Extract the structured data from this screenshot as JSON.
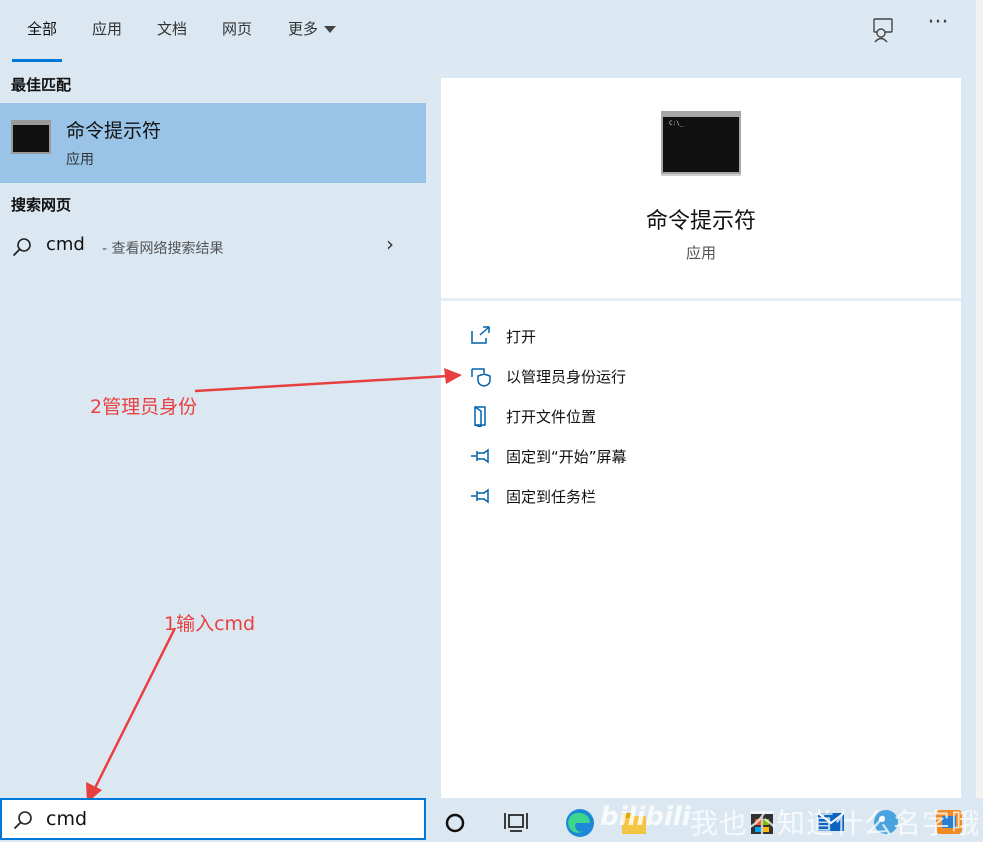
{
  "tabs": [
    {
      "label": "全部",
      "active": true
    },
    {
      "label": "应用"
    },
    {
      "label": "文档"
    },
    {
      "label": "网页"
    },
    {
      "label": "更多"
    }
  ],
  "sections": {
    "best_match": "最佳匹配",
    "search_web": "搜索网页"
  },
  "best_match_item": {
    "title": "命令提示符",
    "subtitle": "应用"
  },
  "web_result": {
    "query": "cmd",
    "hint": " - 查看网络搜索结果"
  },
  "detail": {
    "title": "命令提示符",
    "subtitle": "应用",
    "actions": [
      {
        "label": "打开",
        "icon": "open-icon"
      },
      {
        "label": "以管理员身份运行",
        "icon": "shield-icon"
      },
      {
        "label": "打开文件位置",
        "icon": "folder-icon"
      },
      {
        "label": "固定到“开始”屏幕",
        "icon": "pin-icon"
      },
      {
        "label": "固定到任务栏",
        "icon": "pin-icon"
      }
    ]
  },
  "annotations": {
    "step2": "2管理员身份",
    "step1": "1输入cmd"
  },
  "search": {
    "value": "cmd"
  },
  "watermark": {
    "text": "我也不知道什么名字哦",
    "logo": "bilibili"
  },
  "colors": {
    "accent": "#0078d7",
    "selected": "#99c4e8",
    "annotation": "#e84040"
  }
}
